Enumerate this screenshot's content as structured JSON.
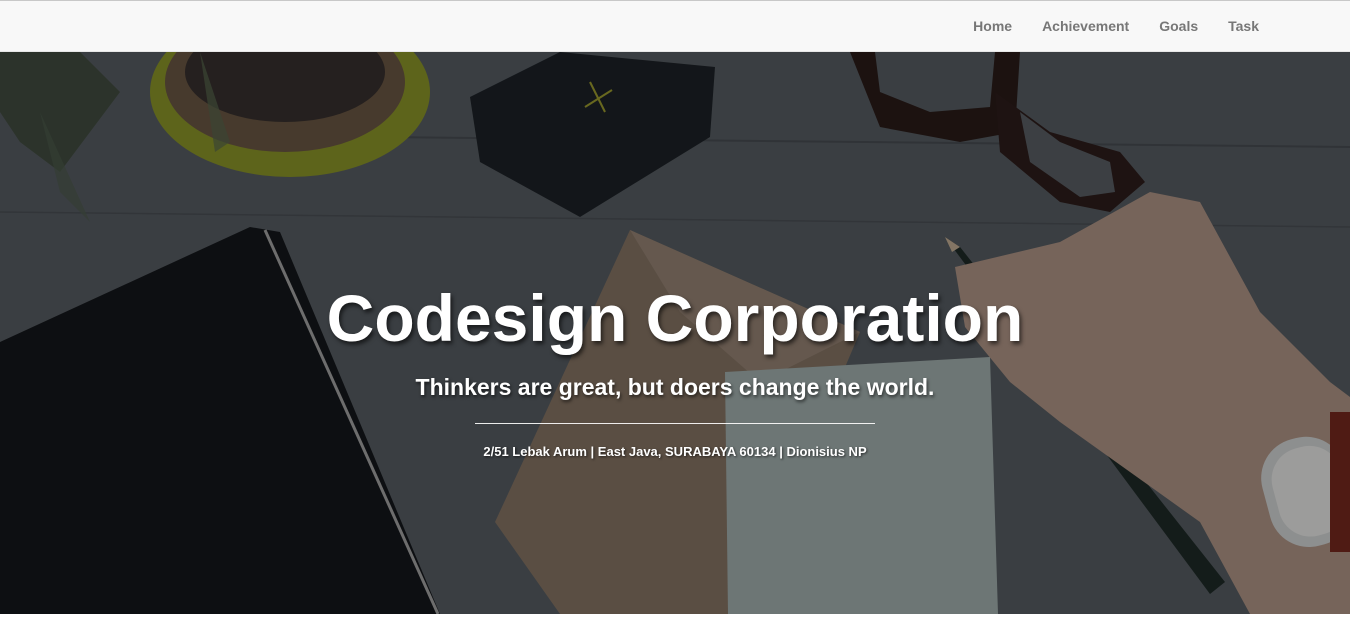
{
  "nav": {
    "items": [
      {
        "label": "Home"
      },
      {
        "label": "Achievement"
      },
      {
        "label": "Goals"
      },
      {
        "label": "Task"
      }
    ]
  },
  "hero": {
    "title": "Codesign Corporation",
    "subtitle": "Thinkers are great, but doers change the world.",
    "address": "2/51 Lebak Arum | East Java, SURABAYA 60134 | Dionisius NP",
    "background_image": "desk-workspace-photo",
    "overlay_color": "#000000"
  },
  "colors": {
    "navbar_bg": "#f8f8f8",
    "nav_text": "#777777",
    "hero_text": "#ffffff"
  }
}
